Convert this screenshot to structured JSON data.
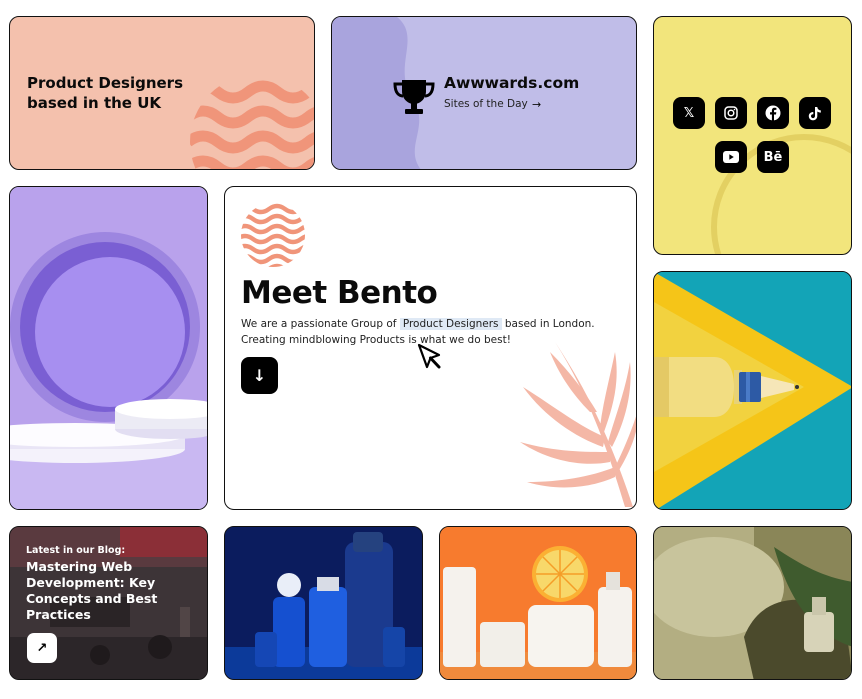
{
  "tagline": {
    "line1": "Product Designers",
    "line2": "based in the UK"
  },
  "awwwards": {
    "title": "Awwwards.com",
    "subtitle": "Sites of the Day",
    "arrow": "→"
  },
  "social": {
    "icons": [
      "x-icon",
      "instagram-icon",
      "facebook-icon",
      "tiktok-icon",
      "youtube-icon",
      "behance-icon"
    ],
    "x_glyph": "𝕏",
    "behance_glyph": "Bē"
  },
  "intro": {
    "title": "Meet Bento",
    "text_before": "We are a passionate Group of ",
    "highlight": "Product Designers",
    "text_after": " based in London. Creating mindblowing Products is what we do best!",
    "scroll_glyph": "↓"
  },
  "blog": {
    "kicker": "Latest in our Blog:",
    "title": "Mastering Web Development: Key Concepts and Best Practices",
    "open_glyph": "↗"
  },
  "colors": {
    "peach": "#f4c1ad",
    "lavender": "#c0bde8",
    "yellow": "#f2e57c",
    "purple": "#b9a2ec",
    "teal": "#13a4b7",
    "salmon": "#f0957a"
  }
}
